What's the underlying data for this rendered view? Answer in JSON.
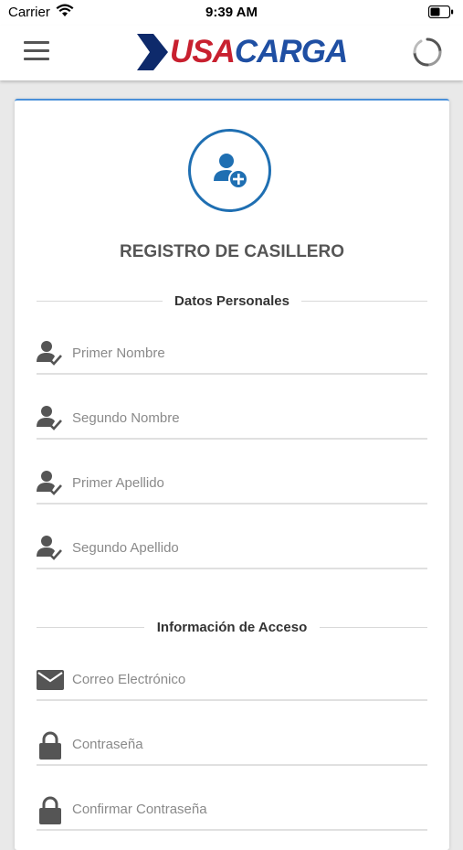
{
  "status_bar": {
    "carrier": "Carrier",
    "time": "9:39 AM"
  },
  "header": {
    "logo_usa": "USA",
    "logo_carga": "CARGA",
    "colors": {
      "logo_red": "#c8202f",
      "logo_blue": "#1f4fa3",
      "logo_navy": "#0e2a6b"
    }
  },
  "form": {
    "title": "REGISTRO DE CASILLERO",
    "sections": {
      "personal": "Datos Personales",
      "access": "Información de Acceso"
    },
    "fields": {
      "first_name": {
        "placeholder": "Primer Nombre",
        "icon": "user-check-icon"
      },
      "second_name": {
        "placeholder": "Segundo Nombre",
        "icon": "user-check-icon"
      },
      "first_surname": {
        "placeholder": "Primer Apellido",
        "icon": "user-check-icon"
      },
      "second_surname": {
        "placeholder": "Segundo Apellido",
        "icon": "user-check-icon"
      },
      "email": {
        "placeholder": "Correo Electrónico",
        "icon": "envelope-icon"
      },
      "password": {
        "placeholder": "Contraseña",
        "icon": "lock-icon"
      },
      "confirm_password": {
        "placeholder": "Confirmar Contraseña",
        "icon": "lock-icon"
      }
    },
    "colors": {
      "accent": "#1f6fb2",
      "card_top_border": "#4a90d9"
    }
  }
}
